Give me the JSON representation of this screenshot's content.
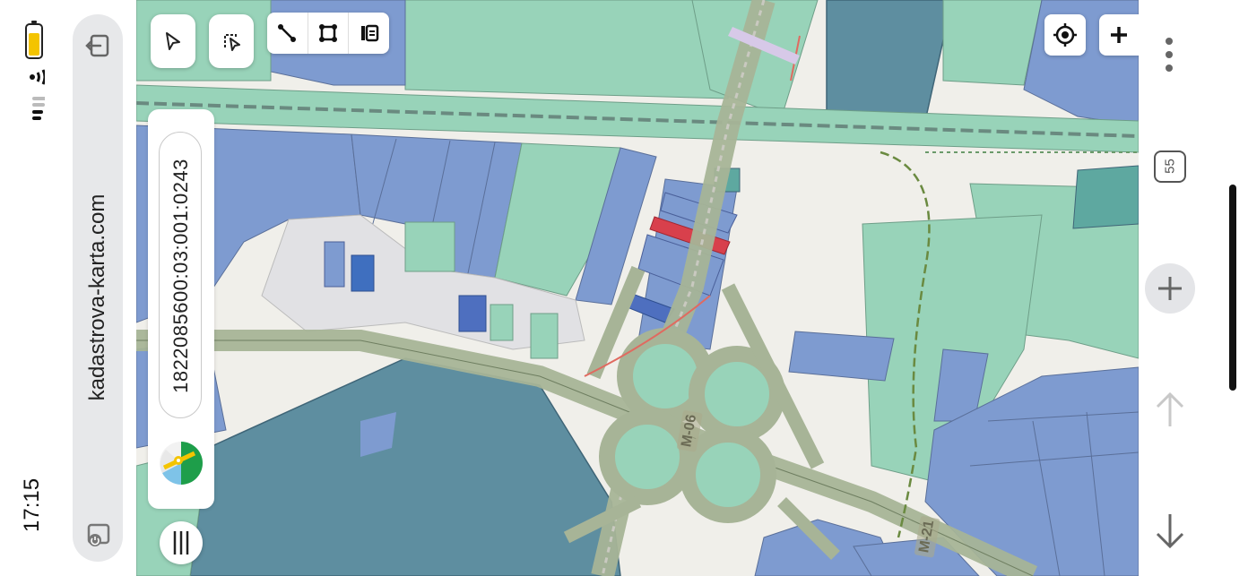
{
  "status_bar": {
    "time": "17:15",
    "battery_icon": "battery-icon",
    "wifi_icon": "wifi-icon",
    "signal_icon": "cellular-signal-icon"
  },
  "browser": {
    "url": "kadastrova-karta.com",
    "exit_icon": "exit-icon",
    "tabs_icon": "tabs-icon"
  },
  "toolbar": {
    "cursor_tool_icon": "cursor-select-icon",
    "lasso_tool_icon": "lasso-select-icon",
    "measure_line_icon": "measure-line-icon",
    "measure_area_icon": "measure-area-icon",
    "layers_icon": "layers-list-icon"
  },
  "side_panel": {
    "cadastral_number": "1822085600:03:001:0243",
    "map_app_icon": "maps-app-icon",
    "menu_icon": "menu-bars-icon"
  },
  "map_controls": {
    "locate_icon": "location-target-icon",
    "zoom_in_icon": "plus-icon"
  },
  "road_labels": {
    "m06": "М-06",
    "m21": "М-21"
  },
  "browser_controls": {
    "more_icon": "more-vertical-icon",
    "tab_count": "55",
    "new_tab_icon": "plus-icon",
    "scroll_up_icon": "arrow-up-icon",
    "scroll_down_icon": "arrow-down-icon"
  },
  "colors": {
    "parcel_blue": "#7e9bd0",
    "parcel_green": "#98d3b9",
    "dark_parcel": "#5e8ea0",
    "road": "#a7b497",
    "highlight_red": "#d8404c",
    "battery_yellow": "#f4c400"
  }
}
